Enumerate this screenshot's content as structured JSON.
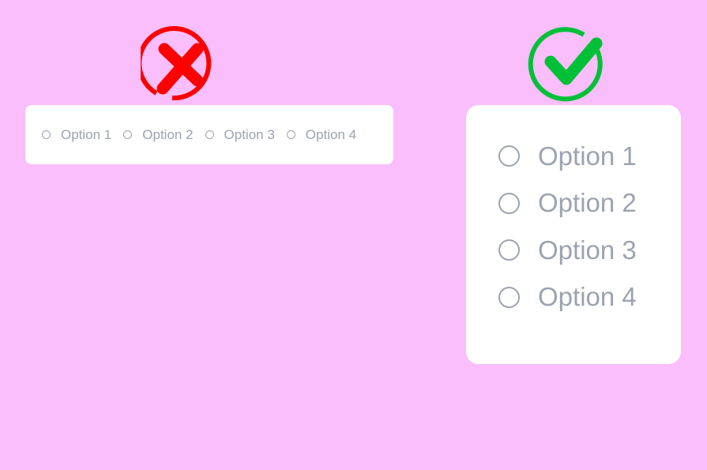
{
  "bad_example": {
    "icon": "x-circle-icon",
    "color": "#ff0000",
    "options": [
      "Option 1",
      "Option 2",
      "Option 3",
      "Option 4"
    ]
  },
  "good_example": {
    "icon": "check-circle-icon",
    "color": "#00c038",
    "options": [
      "Option 1",
      "Option 2",
      "Option 3",
      "Option 4"
    ]
  }
}
